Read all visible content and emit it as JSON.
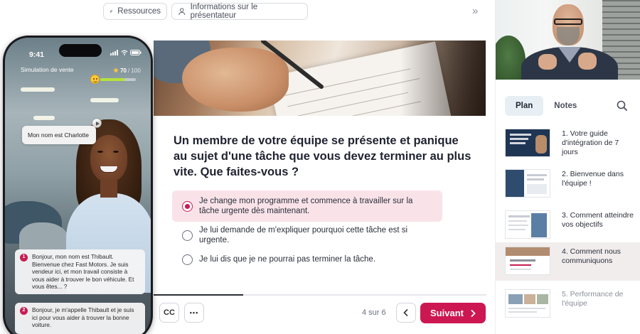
{
  "topbar": {
    "resources_label": "Ressources",
    "presenter_label": "Informations sur le présentateur",
    "collapse_glyph": "»"
  },
  "phone": {
    "time": "9:41",
    "simulation_title": "Simulation de vente",
    "score": "70",
    "score_total": "/ 100",
    "score_progress": 0.7,
    "name_bubble": "Mon nom est Charlotte",
    "messages": [
      {
        "index": "1",
        "text": "Bonjour, mon nom est Thibault. Bienvenue chez Fast Motors. Je suis vendeur ici, et mon travail consiste à vous aider à trouver le bon véhicule. Et vous êtes... ?"
      },
      {
        "index": "2",
        "text": "Bonjour, je m'appelle Thibault et je suis ici pour vous aider à trouver la bonne voiture."
      }
    ]
  },
  "slide": {
    "question": "Un membre de votre équipe se présente et panique au sujet d'une tâche que vous devez terminer au plus vite. Que faites-vous ?",
    "options": [
      {
        "label": "Je change mon programme et commence à travailler sur la tâche urgente dès maintenant.",
        "selected": true
      },
      {
        "label": "Je lui demande de m'expliquer pourquoi cette tâche est si urgente.",
        "selected": false
      },
      {
        "label": "Je lui dis que je ne pourrai pas terminer la tâche.",
        "selected": false
      }
    ]
  },
  "bottombar": {
    "cc_label": "CC",
    "more_label": "•••",
    "counter": "4 sur 6",
    "progress": 0.27,
    "next_label": "Suivant"
  },
  "rightpanel": {
    "tabs": [
      "Plan",
      "Notes"
    ],
    "active_tab": "Plan",
    "outline": [
      {
        "title": "1. Votre guide d'intégration de 7 jours",
        "active": false,
        "faded": false
      },
      {
        "title": "2. Bienvenue dans l'équipe !",
        "active": false,
        "faded": false
      },
      {
        "title": "3. Comment atteindre vos objectifs",
        "active": false,
        "faded": false
      },
      {
        "title": "4. Comment nous communiquons",
        "active": true,
        "faded": false
      },
      {
        "title": "5. Performance de l'équipe",
        "active": false,
        "faded": true
      }
    ]
  },
  "colors": {
    "accent": "#cc1752",
    "selected_option_bg": "#f9e3e9",
    "active_outline_bg": "#f1eded",
    "active_tab_bg": "#e7eef4"
  },
  "icons": {
    "resources": "paperclip-icon",
    "presenter": "user-icon",
    "collapse": "double-chevron-right-icon",
    "search": "search-icon",
    "prev": "chevron-left-icon",
    "next": "chevron-right-icon"
  }
}
